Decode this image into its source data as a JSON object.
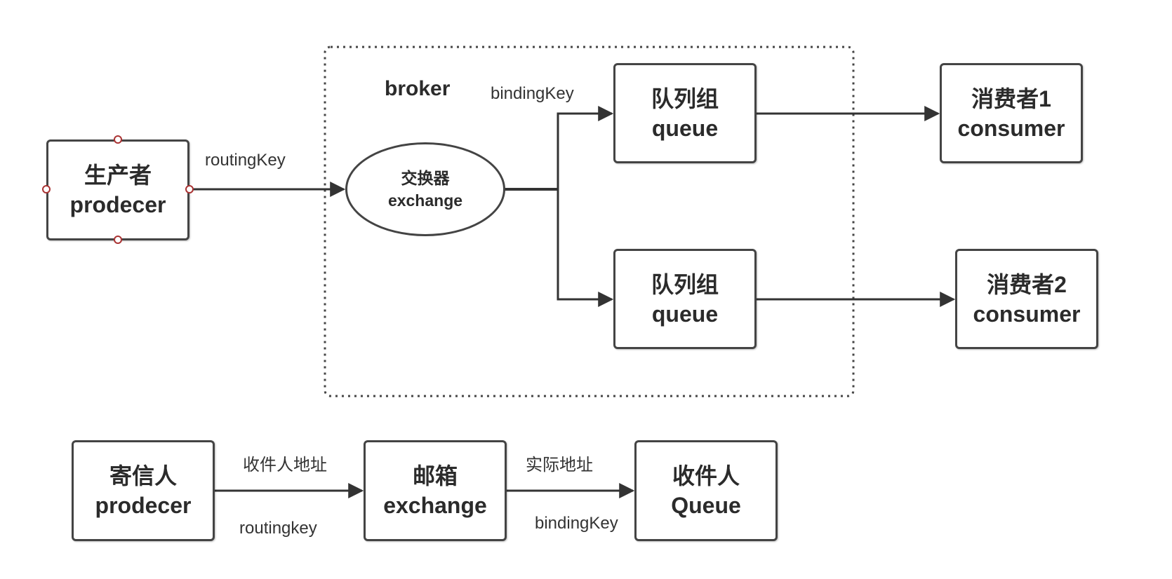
{
  "broker": {
    "label": "broker"
  },
  "top": {
    "producer": {
      "line1": "生产者",
      "line2": "prodecer"
    },
    "routing_key": "routingKey",
    "exchange": {
      "line1": "交换器",
      "line2": "exchange"
    },
    "binding_key": "bindingKey",
    "queue1": {
      "line1": "队列组",
      "line2": "queue"
    },
    "queue2": {
      "line1": "队列组",
      "line2": "queue"
    },
    "consumer1": {
      "line1": "消费者1",
      "line2": "consumer"
    },
    "consumer2": {
      "line1": "消费者2",
      "line2": "consumer"
    }
  },
  "bottom": {
    "sender": {
      "line1": "寄信人",
      "line2": "prodecer"
    },
    "address_label": "收件人地址",
    "routing_key_label": "routingkey",
    "mailbox": {
      "line1": "邮箱",
      "line2": "exchange"
    },
    "actual_address_label": "实际地址",
    "binding_key_label": "bindingKey",
    "recipient": {
      "line1": "收件人",
      "line2": "Queue"
    }
  }
}
